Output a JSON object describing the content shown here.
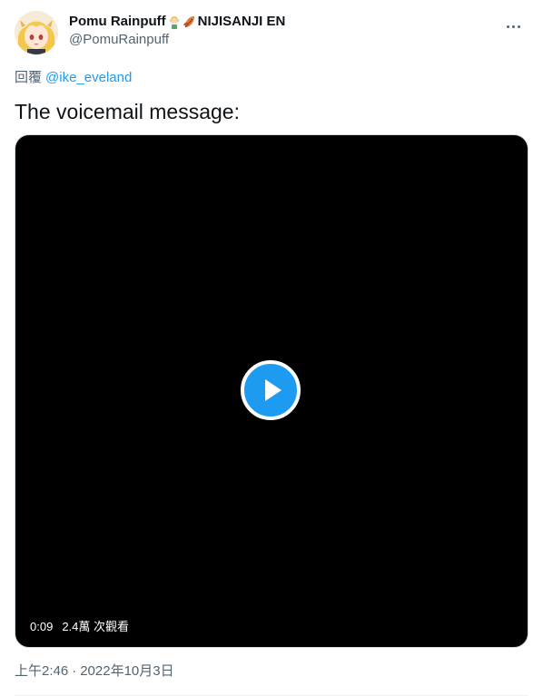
{
  "author": {
    "display_name": "Pomu Rainpuff",
    "name_suffix": "NIJISANJI EN",
    "handle": "@PomuRainpuff",
    "emojis": [
      "fairy-emoji",
      "leaf-emoji"
    ],
    "avatar_icon": "avatar"
  },
  "menu": {
    "icon": "more-icon"
  },
  "reply": {
    "label": "回覆",
    "mention": "@ike_eveland"
  },
  "tweet": {
    "text": "The voicemail message:"
  },
  "video": {
    "duration": "0:09",
    "views": "2.4萬 次觀看",
    "play_icon": "play-icon"
  },
  "timestamp": {
    "time": "上午2:46",
    "separator": "·",
    "date": "2022年10月3日"
  },
  "colors": {
    "accent": "#1d9bf0",
    "secondary_text": "#536471",
    "primary_text": "#0f1419",
    "video_bg": "#000000"
  }
}
